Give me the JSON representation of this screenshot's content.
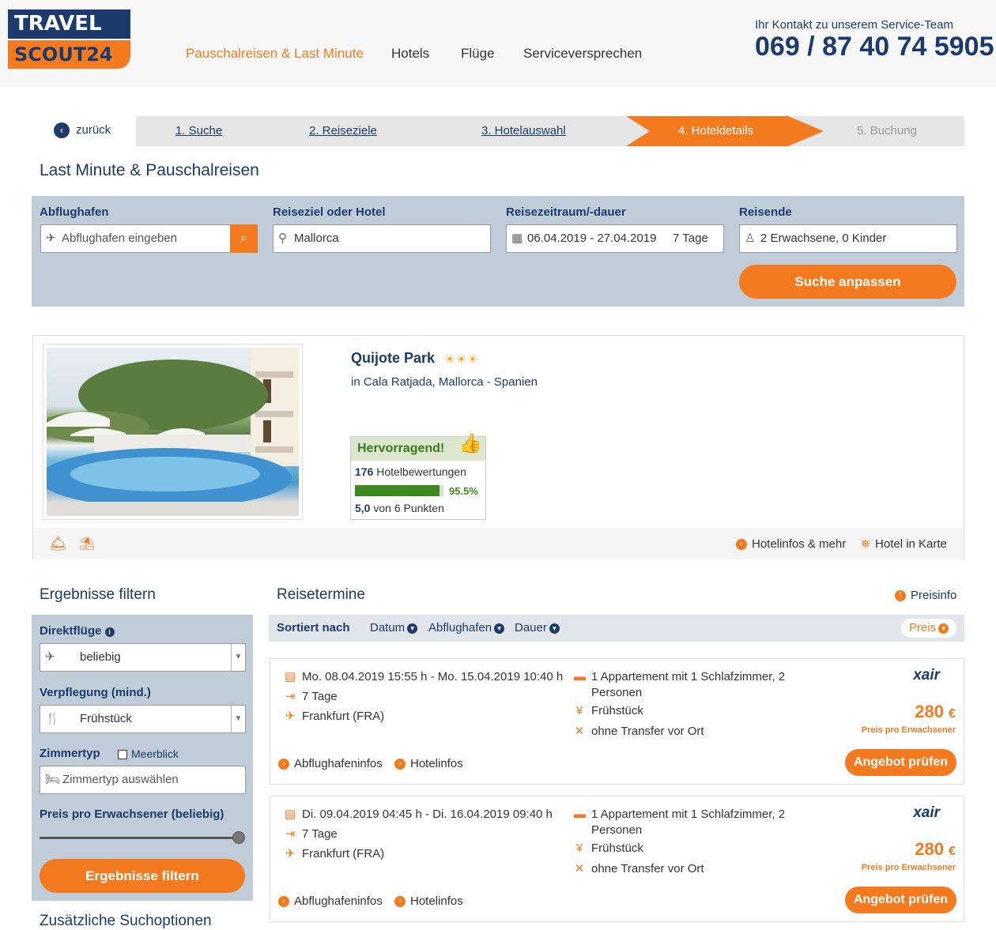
{
  "header": {
    "logo_top": "TRAVEL",
    "logo_bottom": "SCOUT24",
    "nav": [
      "Pauschalreisen & Last Minute",
      "Hotels",
      "Flüge",
      "Serviceversprechen"
    ],
    "contact_label": "Ihr Kontakt zu unserem Service-Team",
    "contact_phone": "069 / 87 40 74 5905"
  },
  "steps": {
    "back": "zurück",
    "items": [
      "1. Suche",
      "2. Reiseziele",
      "3. Hotelauswahl",
      "4. Hoteldetails",
      "5. Buchung"
    ]
  },
  "page_title": "Last Minute & Pauschalreisen",
  "search": {
    "departure_label": "Abflughafen",
    "departure_placeholder": "Abflughafen eingeben",
    "destination_label": "Reiseziel oder Hotel",
    "destination_value": "Mallorca",
    "period_label": "Reisezeitraum/-dauer",
    "period_value": "06.04.2019 - 27.04.2019",
    "duration_value": "7 Tage",
    "travelers_label": "Reisende",
    "travelers_value": "2 Erwachsene, 0 Kinder",
    "submit": "Suche anpassen"
  },
  "hotel": {
    "name": "Quijote Park",
    "stars": "☀☀☀",
    "location": "in Cala Ratjada, Mallorca - Spanien",
    "rating_label": "Hervorragend!",
    "reviews_count": "176",
    "reviews_label": "Hotelbewertungen",
    "recommend_pct": "95.5%",
    "recommend_fraction": 0.955,
    "score": "5,0",
    "score_suffix": "von 6 Punkten",
    "link_info": "Hotelinfos & mehr",
    "link_map": "Hotel in Karte"
  },
  "filters": {
    "title": "Ergebnisse filtern",
    "direct_label": "Direktflüge",
    "direct_value": "beliebig",
    "board_label": "Verpflegung (mind.)",
    "board_value": "Frühstück",
    "room_label": "Zimmertyp",
    "seaview_label": "Meerblick",
    "room_placeholder": "Zimmertyp auswählen",
    "price_label": "Preis pro Erwachsener (beliebig)",
    "submit": "Ergebnisse filtern",
    "more_options": "Zusätzliche Suchoptionen"
  },
  "results": {
    "title": "Reisetermine",
    "price_info": "Preisinfo",
    "sort_label": "Sortiert nach",
    "sort_options": [
      "Datum",
      "Abflughafen",
      "Dauer",
      "Preis"
    ],
    "items": [
      {
        "dates": "Mo. 08.04.2019 15:55 h - Mo. 15.04.2019 10:40 h",
        "duration": "7 Tage",
        "airport": "Frankfurt (FRA)",
        "room_line1": "1 Appartement mit 1 Schlafzimmer, 2",
        "room_line2": "Personen",
        "board": "Frühstück",
        "transfer": "ohne Transfer vor Ort",
        "operator": "xair",
        "price": "280",
        "currency": "€",
        "price_note": "Preis pro Erwachsener",
        "link_airport": "Abflughafeninfos",
        "link_hotel": "Hotelinfos",
        "button": "Angebot prüfen"
      },
      {
        "dates": "Di. 09.04.2019 04:45 h - Di. 16.04.2019 09:40 h",
        "duration": "7 Tage",
        "airport": "Frankfurt (FRA)",
        "room_line1": "1 Appartement mit 1 Schlafzimmer, 2",
        "room_line2": "Personen",
        "board": "Frühstück",
        "transfer": "ohne Transfer vor Ort",
        "operator": "xair",
        "price": "280",
        "currency": "€",
        "price_note": "Preis pro Erwachsener",
        "link_airport": "Abflughafeninfos",
        "link_hotel": "Hotelinfos",
        "button": "Angebot prüfen"
      }
    ]
  },
  "colors": {
    "brand_navy": "#1c3a6b",
    "accent_orange": "#f47a20",
    "filter_bg": "#c0ccd8",
    "rating_green": "#3c8a1e"
  }
}
